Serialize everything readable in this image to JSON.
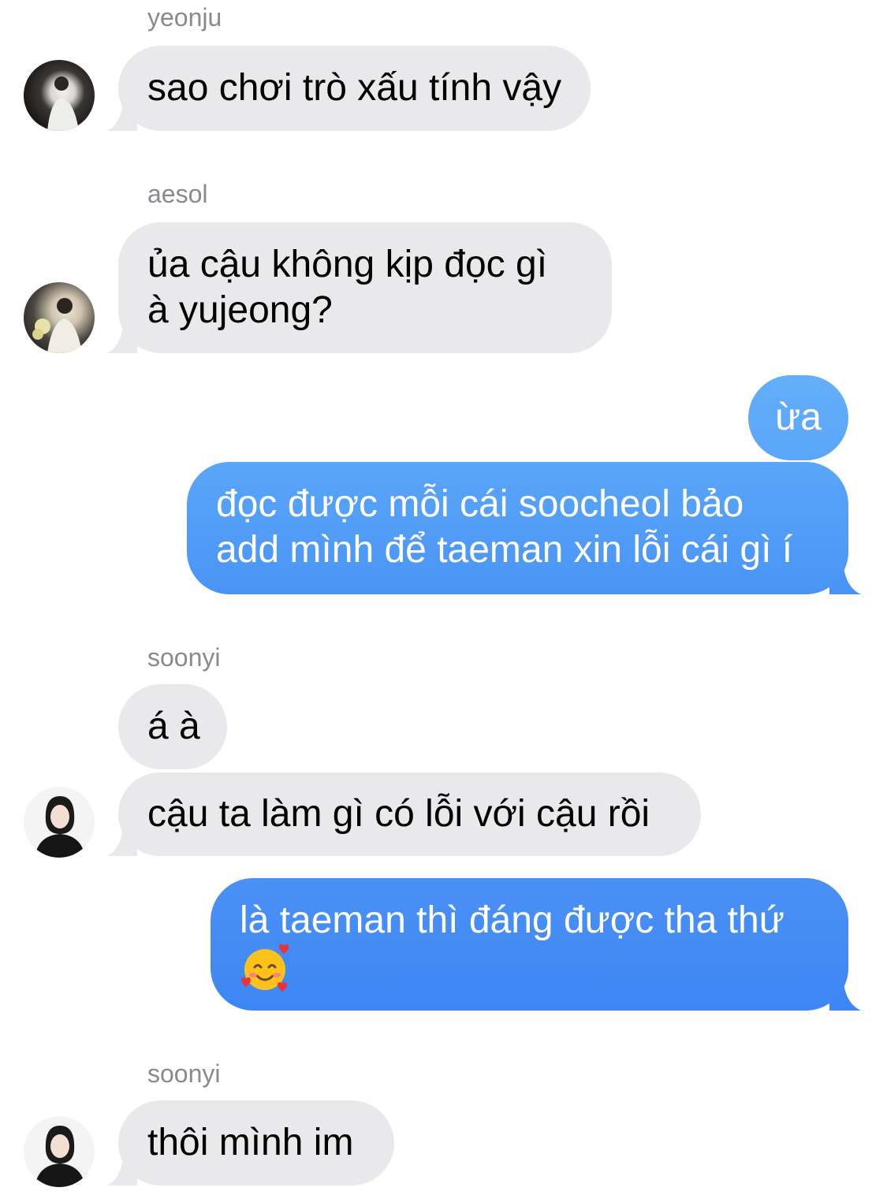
{
  "colors": {
    "incoming_bubble": "#e9e9eb",
    "outgoing_bubble_top": "#54a3f8",
    "outgoing_bubble_bottom": "#3e86f4",
    "sender_name": "#8a8a8e"
  },
  "messages": [
    {
      "type": "sender",
      "name": "yeonju"
    },
    {
      "type": "incoming",
      "lines": [
        "sao chơi trò xấu tính vậy"
      ],
      "avatar": "avatar-yeonju"
    },
    {
      "type": "sender",
      "name": "aesol"
    },
    {
      "type": "incoming",
      "lines": [
        "ủa cậu không kịp đọc gì",
        "à yujeong?"
      ],
      "avatar": "avatar-aesol"
    },
    {
      "type": "outgoing",
      "lines": [
        "ừa"
      ]
    },
    {
      "type": "outgoing",
      "lines": [
        "đọc được mỗi cái soocheol bảo",
        "add mình để taeman xin lỗi cái gì í"
      ]
    },
    {
      "type": "sender",
      "name": "soonyi"
    },
    {
      "type": "incoming",
      "lines": [
        "á à"
      ]
    },
    {
      "type": "incoming",
      "lines": [
        "cậu ta làm gì có lỗi với cậu rồi"
      ],
      "avatar": "avatar-soonyi"
    },
    {
      "type": "outgoing",
      "lines": [
        "là taeman thì đáng được tha thứ"
      ],
      "emoji": "smiling-face-with-hearts-icon"
    },
    {
      "type": "sender",
      "name": "soonyi"
    },
    {
      "type": "incoming",
      "lines": [
        "thôi mình im"
      ],
      "avatar": "avatar-soonyi"
    }
  ]
}
